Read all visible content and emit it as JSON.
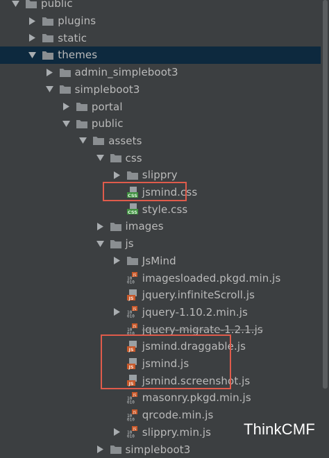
{
  "tree": [
    {
      "label": "public",
      "type": "folder",
      "arrow": "down",
      "depth": 0
    },
    {
      "label": "plugins",
      "type": "folder",
      "arrow": "right",
      "depth": 1
    },
    {
      "label": "static",
      "type": "folder",
      "arrow": "right",
      "depth": 1
    },
    {
      "label": "themes",
      "type": "folder",
      "arrow": "down",
      "depth": 1,
      "selected": true
    },
    {
      "label": "admin_simpleboot3",
      "type": "folder",
      "arrow": "right",
      "depth": 2
    },
    {
      "label": "simpleboot3",
      "type": "folder",
      "arrow": "down",
      "depth": 2
    },
    {
      "label": "portal",
      "type": "folder",
      "arrow": "right",
      "depth": 3
    },
    {
      "label": "public",
      "type": "folder",
      "arrow": "down",
      "depth": 3
    },
    {
      "label": "assets",
      "type": "folder",
      "arrow": "down",
      "depth": 4
    },
    {
      "label": "css",
      "type": "folder",
      "arrow": "down",
      "depth": 5
    },
    {
      "label": "slippry",
      "type": "folder",
      "arrow": "right",
      "depth": 6
    },
    {
      "label": "jsmind.css",
      "type": "css",
      "arrow": "none",
      "depth": 6
    },
    {
      "label": "style.css",
      "type": "css",
      "arrow": "none",
      "depth": 6
    },
    {
      "label": "images",
      "type": "folder",
      "arrow": "right",
      "depth": 5
    },
    {
      "label": "js",
      "type": "folder",
      "arrow": "down",
      "depth": 5
    },
    {
      "label": "JsMind",
      "type": "folder",
      "arrow": "right",
      "depth": 6
    },
    {
      "label": "imagesloaded.pkgd.min.js",
      "type": "minjs",
      "arrow": "none",
      "depth": 6
    },
    {
      "label": "jquery.infiniteScroll.js",
      "type": "js",
      "arrow": "none",
      "depth": 6
    },
    {
      "label": "jquery-1.10.2.min.js",
      "type": "minjs",
      "arrow": "right",
      "depth": 6
    },
    {
      "label": "jquery-migrate-1.2.1.js",
      "type": "minjs",
      "arrow": "none",
      "depth": 6,
      "strike": true
    },
    {
      "label": "jsmind.draggable.js",
      "type": "js",
      "arrow": "none",
      "depth": 6
    },
    {
      "label": "jsmind.js",
      "type": "js",
      "arrow": "none",
      "depth": 6
    },
    {
      "label": "jsmind.screenshot.js",
      "type": "js",
      "arrow": "none",
      "depth": 6
    },
    {
      "label": "masonry.pkgd.min.js",
      "type": "minjs",
      "arrow": "none",
      "depth": 6
    },
    {
      "label": "qrcode.min.js",
      "type": "minjs",
      "arrow": "none",
      "depth": 6
    },
    {
      "label": "slippry.min.js",
      "type": "minjs",
      "arrow": "right",
      "depth": 6
    },
    {
      "label": "simpleboot3",
      "type": "folder",
      "arrow": "right",
      "depth": 5
    }
  ],
  "watermark": "ThinkCMF",
  "colors": {
    "background": "#3c3f41",
    "selected": "#0d293e",
    "highlight": "#e05b4b",
    "text": "#bbbbbb",
    "folder": "#8a8e91",
    "css_badge": "#3f8f3f",
    "js_badge": "#c8592b"
  }
}
